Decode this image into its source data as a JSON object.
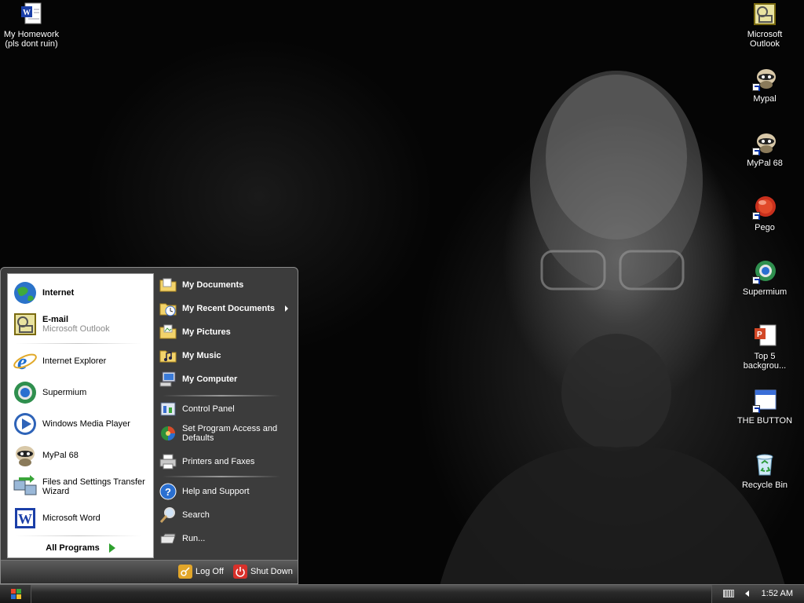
{
  "desktop": {
    "left_icons": [
      {
        "label": "My Homework\n(pls dont ruin)",
        "icon": "word-document-icon"
      }
    ],
    "right_icons": [
      {
        "label": "Microsoft\nOutlook",
        "icon": "outlook-icon"
      },
      {
        "label": "Mypal",
        "icon": "mypal-icon"
      },
      {
        "label": "MyPal 68",
        "icon": "mypal-icon"
      },
      {
        "label": "Pego",
        "icon": "pego-icon"
      },
      {
        "label": "Supermium",
        "icon": "supermium-icon"
      },
      {
        "label": "Top 5\nbackgrou...",
        "icon": "powerpoint-icon"
      },
      {
        "label": "THE BUTTON",
        "icon": "window-icon"
      },
      {
        "label": "Recycle Bin",
        "icon": "recycle-bin-icon"
      }
    ]
  },
  "start_menu": {
    "pinned": [
      {
        "label": "Internet",
        "icon": "internet-globe-icon"
      },
      {
        "label": "E-mail",
        "sublabel": "Microsoft Outlook",
        "icon": "outlook-icon"
      }
    ],
    "recent": [
      {
        "label": "Internet Explorer",
        "icon": "internet-explorer-icon"
      },
      {
        "label": "Supermium",
        "icon": "supermium-icon"
      },
      {
        "label": "Windows Media Player",
        "icon": "media-player-icon"
      },
      {
        "label": "MyPal 68",
        "icon": "mypal-icon"
      },
      {
        "label": "Files and Settings Transfer Wizard",
        "icon": "transfer-wizard-icon"
      },
      {
        "label": "Microsoft Word",
        "icon": "word-icon"
      }
    ],
    "all_programs": "All Programs",
    "places_bold": [
      {
        "label": "My Documents",
        "icon": "folder-icon"
      },
      {
        "label": "My Recent Documents",
        "icon": "recent-documents-icon"
      },
      {
        "label": "My Pictures",
        "icon": "folder-icon"
      },
      {
        "label": "My Music",
        "icon": "folder-icon"
      },
      {
        "label": "My Computer",
        "icon": "computer-icon"
      }
    ],
    "system": [
      {
        "label": "Control Panel",
        "icon": "control-panel-icon"
      },
      {
        "label": "Set Program Access and Defaults",
        "icon": "program-defaults-icon"
      },
      {
        "label": "Printers and Faxes",
        "icon": "printer-icon"
      }
    ],
    "help": [
      {
        "label": "Help and Support",
        "icon": "help-icon"
      },
      {
        "label": "Search",
        "icon": "search-icon"
      },
      {
        "label": "Run...",
        "icon": "run-icon"
      }
    ],
    "log_off": "Log Off",
    "shut_down": "Shut Down"
  },
  "taskbar": {
    "clock": "1:52 AM"
  }
}
